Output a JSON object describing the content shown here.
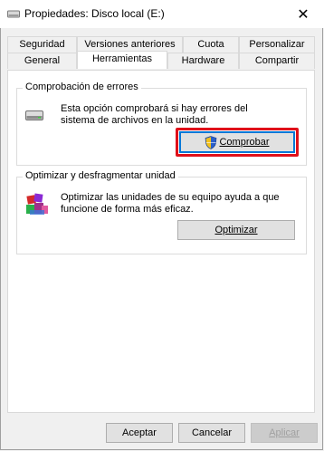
{
  "window": {
    "title": "Propiedades: Disco local (E:)",
    "close_glyph": "✕"
  },
  "tabs": {
    "row1": [
      "Seguridad",
      "Versiones anteriores",
      "Cuota",
      "Personalizar"
    ],
    "row2": [
      "General",
      "Herramientas",
      "Hardware",
      "Compartir"
    ],
    "active": "Herramientas"
  },
  "error_check": {
    "legend": "Comprobación de errores",
    "line1": "Esta opción comprobará si hay errores del",
    "line2": "sistema de archivos en la unidad.",
    "button_label": "Comprobar",
    "button_icon": "uac-shield-icon",
    "highlight_color": "#e0101a"
  },
  "optimize": {
    "legend": "Optimizar y desfragmentar unidad",
    "line1": "Optimizar las unidades de su equipo ayuda a que",
    "line2": "funcione de forma más eficaz.",
    "button_label": "Optimizar",
    "icon": "defrag-icon"
  },
  "footer": {
    "ok": "Aceptar",
    "cancel": "Cancelar",
    "apply": "Aplicar"
  }
}
